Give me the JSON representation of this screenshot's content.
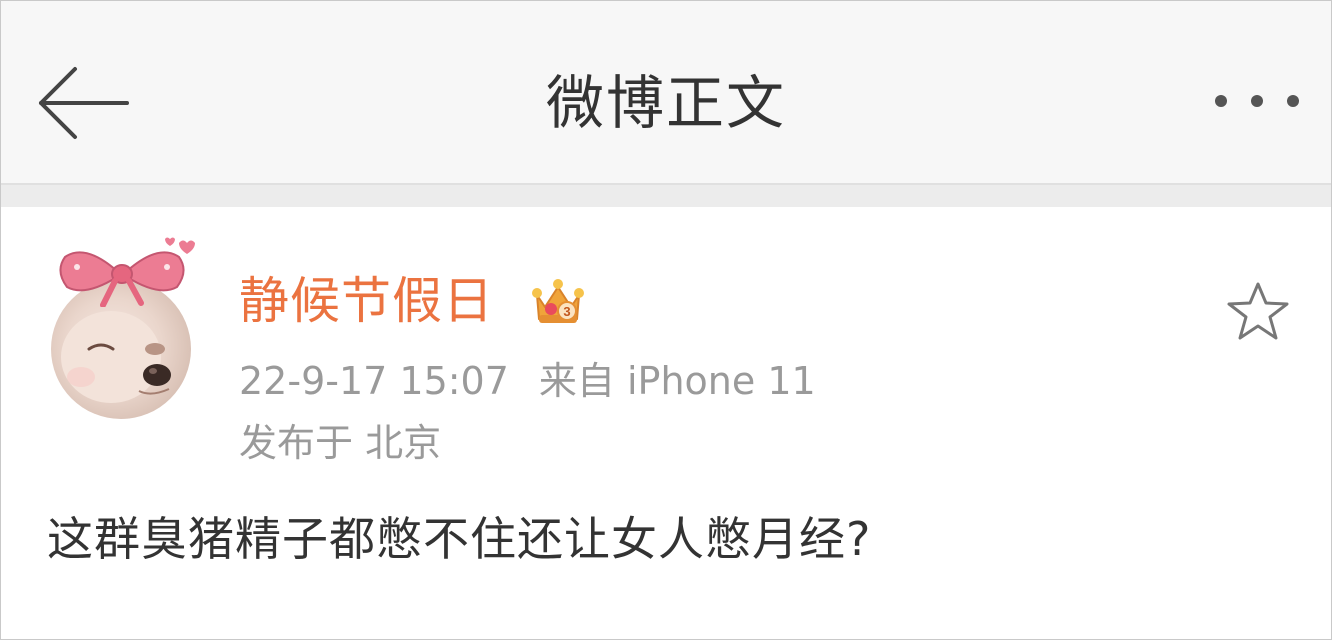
{
  "header": {
    "title": "微博正文",
    "back_icon": "arrow-left-icon",
    "more_icon": "more-horizontal-icon"
  },
  "post": {
    "username": "静候节假日",
    "badge_icon": "crown-vip-icon",
    "badge_level": "3",
    "time": "22-9-17 15:07",
    "source": "来自 iPhone 11",
    "location": "发布于 北京",
    "content": "这群臭猪精子都憋不住还让女人憋月经?",
    "favorite_icon": "star-outline-icon"
  },
  "colors": {
    "username": "#eb7340",
    "header_bg": "#f7f7f7",
    "meta_text": "#9a9a9a",
    "content_text": "#333333",
    "bow": "#e8738a"
  }
}
